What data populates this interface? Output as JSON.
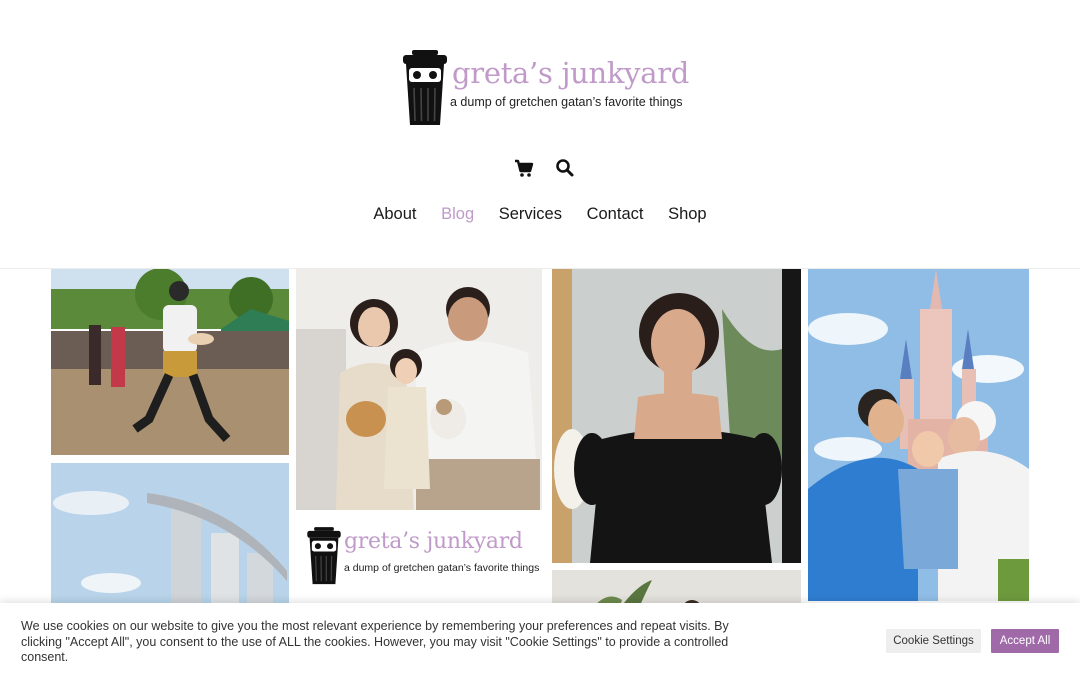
{
  "site": {
    "title": "greta’s junkyard",
    "tagline": "a dump of gretchen gatan’s favorite things"
  },
  "header_icons": [
    "shopping-cart-icon",
    "search-icon"
  ],
  "nav": {
    "items": [
      {
        "label": "About"
      },
      {
        "label": "Blog"
      },
      {
        "label": "Services"
      },
      {
        "label": "Contact"
      },
      {
        "label": "Shop"
      }
    ],
    "active": "Blog"
  },
  "gallery": {
    "logo_tile": {
      "title": "greta’s junkyard",
      "tagline": "a dump of gretchen gatan’s favorite things"
    }
  },
  "cookie": {
    "text": "We use cookies on our website to give you the most relevant experience by remembering your preferences and repeat visits. By clicking \"Accept All\", you consent to the use of ALL the cookies. However, you may visit \"Cookie Settings\" to provide a controlled consent.",
    "settings_label": "Cookie Settings",
    "accept_label": "Accept All"
  },
  "colors": {
    "brand": "#c09ac8",
    "accept_button": "#a06aa9"
  }
}
